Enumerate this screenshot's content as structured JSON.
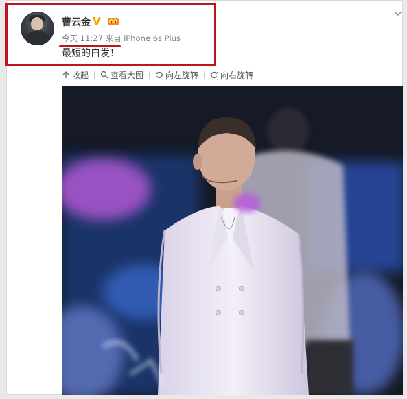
{
  "post": {
    "username": "曹云金",
    "time": "今天 11:27",
    "source_prefix": "来自",
    "source": "iPhone 6s Plus",
    "text": "最短的白发！"
  },
  "toolbar": {
    "collapse": "收起",
    "view_large": "查看大图",
    "rotate_left": "向左旋转",
    "rotate_right": "向右旋转"
  },
  "icons": {
    "verified": "verified-v-icon",
    "member": "member-crown-icon",
    "expand": "chevron-down-icon"
  },
  "colors": {
    "highlight": "#c0141c",
    "verified": "#f5a300",
    "meta_text": "#808080"
  }
}
